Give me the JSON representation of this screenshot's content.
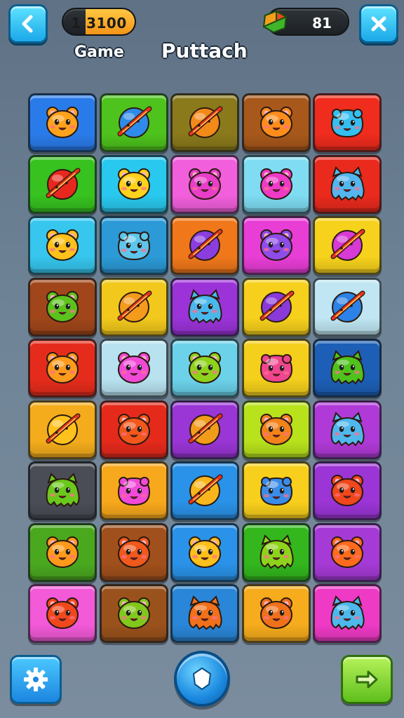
{
  "header": {
    "back_icon": "chevron-left-icon",
    "score_text": "1 3100",
    "coin_icon": "gem-icon",
    "coin_count": "81",
    "close_icon": "close-icon",
    "game_label": "Game",
    "title": "Puttach"
  },
  "board": {
    "rows": 9,
    "cols": 5,
    "tiles": [
      [
        {
          "bg": "#2a7bea",
          "c": "#ffa21c",
          "t": "bear"
        },
        {
          "bg": "#4ec31d",
          "c": "#2f8bea",
          "t": "planet"
        },
        {
          "bg": "#8a7a1c",
          "c": "#f28a1a",
          "t": "planet"
        },
        {
          "bg": "#a8581a",
          "c": "#ff8d1c",
          "t": "bear"
        },
        {
          "bg": "#ef2c1d",
          "c": "#35bff0",
          "t": "blob"
        }
      ],
      [
        {
          "bg": "#37c21f",
          "c": "#e8281e",
          "t": "planet"
        },
        {
          "bg": "#29c8ee",
          "c": "#ffd21c",
          "t": "bear"
        },
        {
          "bg": "#f25fdc",
          "c": "#e83ec8",
          "t": "bear"
        },
        {
          "bg": "#7fdcf2",
          "c": "#ef3ac6",
          "t": "bear"
        },
        {
          "bg": "#ea2a1d",
          "c": "#54b6ee",
          "t": "monster"
        }
      ],
      [
        {
          "bg": "#36c6ee",
          "c": "#ffc21c",
          "t": "bear"
        },
        {
          "bg": "#2b9ad6",
          "c": "#5ec6ec",
          "t": "blob"
        },
        {
          "bg": "#f0781a",
          "c": "#8b3ee0",
          "t": "planet"
        },
        {
          "bg": "#e83ed6",
          "c": "#8e4ce8",
          "t": "bear"
        },
        {
          "bg": "#f7d21c",
          "c": "#d83ad6",
          "t": "planet"
        }
      ],
      [
        {
          "bg": "#a0461a",
          "c": "#5cc21c",
          "t": "bear"
        },
        {
          "bg": "#f2c81c",
          "c": "#f49a1c",
          "t": "planet"
        },
        {
          "bg": "#9b33d8",
          "c": "#4ab8ec",
          "t": "monster"
        },
        {
          "bg": "#f6d01c",
          "c": "#8a3ad8",
          "t": "planet"
        },
        {
          "bg": "#bfe6f2",
          "c": "#2c82e6",
          "t": "planet"
        }
      ],
      [
        {
          "bg": "#e52c1c",
          "c": "#ff9b1c",
          "t": "bear"
        },
        {
          "bg": "#b8e2f0",
          "c": "#f04ad6",
          "t": "bear"
        },
        {
          "bg": "#6cd2ea",
          "c": "#8fd21c",
          "t": "bear"
        },
        {
          "bg": "#f4cf1c",
          "c": "#f0468e",
          "t": "blob"
        },
        {
          "bg": "#1d5fb6",
          "c": "#4fc21c",
          "t": "monster"
        }
      ],
      [
        {
          "bg": "#f4ac1c",
          "c": "#ffc21c",
          "t": "planet"
        },
        {
          "bg": "#e52a1c",
          "c": "#f2571c",
          "t": "bear"
        },
        {
          "bg": "#9a35d6",
          "c": "#f29c1c",
          "t": "planet"
        },
        {
          "bg": "#b8e21c",
          "c": "#f2821c",
          "t": "bear"
        },
        {
          "bg": "#b03ad8",
          "c": "#4fb8ec",
          "t": "monster"
        }
      ],
      [
        {
          "bg": "#4a4d56",
          "c": "#6bc81c",
          "t": "monster"
        },
        {
          "bg": "#f8a81c",
          "c": "#f24ad8",
          "t": "blob"
        },
        {
          "bg": "#2a92e8",
          "c": "#f8b61c",
          "t": "planet"
        },
        {
          "bg": "#f8cf1c",
          "c": "#3a8ce8",
          "t": "blob"
        },
        {
          "bg": "#9b35d6",
          "c": "#f0471c",
          "t": "bear"
        }
      ],
      [
        {
          "bg": "#4aa81f",
          "c": "#ff9a1c",
          "t": "bear"
        },
        {
          "bg": "#a0501c",
          "c": "#f0581c",
          "t": "bear"
        },
        {
          "bg": "#2a92e8",
          "c": "#ffbf1c",
          "t": "bear"
        },
        {
          "bg": "#33b71d",
          "c": "#8fd21c",
          "t": "monster"
        },
        {
          "bg": "#a53ad6",
          "c": "#ff6a1c",
          "t": "bear"
        }
      ],
      [
        {
          "bg": "#f25ad8",
          "c": "#f0481c",
          "t": "bear"
        },
        {
          "bg": "#9a521c",
          "c": "#82c81c",
          "t": "bear"
        },
        {
          "bg": "#2a86d8",
          "c": "#f0701c",
          "t": "monster"
        },
        {
          "bg": "#f6ac1c",
          "c": "#f0701c",
          "t": "bear"
        },
        {
          "bg": "#ef3ac6",
          "c": "#4cb8ec",
          "t": "monster"
        }
      ]
    ]
  },
  "footer": {
    "settings_icon": "gear-icon",
    "center_icon": "shield-icon",
    "next_icon": "arrow-right-icon"
  }
}
